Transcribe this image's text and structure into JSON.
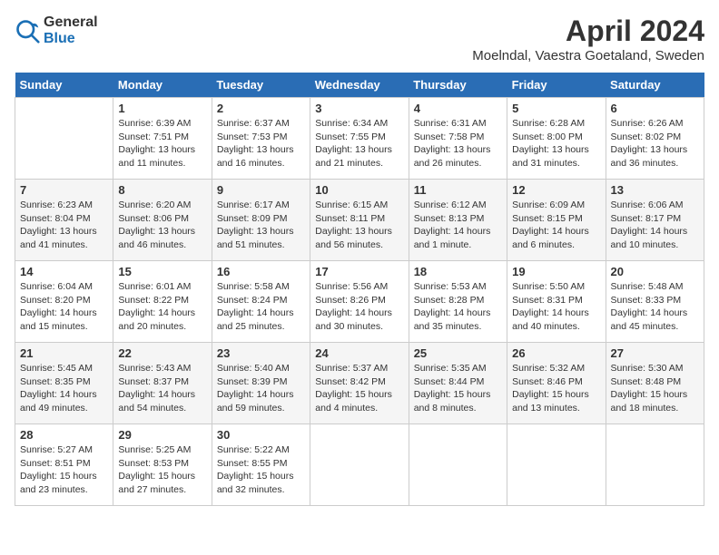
{
  "header": {
    "logo_general": "General",
    "logo_blue": "Blue",
    "month_title": "April 2024",
    "location": "Moelndal, Vaestra Goetaland, Sweden"
  },
  "days_of_week": [
    "Sunday",
    "Monday",
    "Tuesday",
    "Wednesday",
    "Thursday",
    "Friday",
    "Saturday"
  ],
  "weeks": [
    [
      {
        "day": "",
        "info": ""
      },
      {
        "day": "1",
        "info": "Sunrise: 6:39 AM\nSunset: 7:51 PM\nDaylight: 13 hours\nand 11 minutes."
      },
      {
        "day": "2",
        "info": "Sunrise: 6:37 AM\nSunset: 7:53 PM\nDaylight: 13 hours\nand 16 minutes."
      },
      {
        "day": "3",
        "info": "Sunrise: 6:34 AM\nSunset: 7:55 PM\nDaylight: 13 hours\nand 21 minutes."
      },
      {
        "day": "4",
        "info": "Sunrise: 6:31 AM\nSunset: 7:58 PM\nDaylight: 13 hours\nand 26 minutes."
      },
      {
        "day": "5",
        "info": "Sunrise: 6:28 AM\nSunset: 8:00 PM\nDaylight: 13 hours\nand 31 minutes."
      },
      {
        "day": "6",
        "info": "Sunrise: 6:26 AM\nSunset: 8:02 PM\nDaylight: 13 hours\nand 36 minutes."
      }
    ],
    [
      {
        "day": "7",
        "info": "Sunrise: 6:23 AM\nSunset: 8:04 PM\nDaylight: 13 hours\nand 41 minutes."
      },
      {
        "day": "8",
        "info": "Sunrise: 6:20 AM\nSunset: 8:06 PM\nDaylight: 13 hours\nand 46 minutes."
      },
      {
        "day": "9",
        "info": "Sunrise: 6:17 AM\nSunset: 8:09 PM\nDaylight: 13 hours\nand 51 minutes."
      },
      {
        "day": "10",
        "info": "Sunrise: 6:15 AM\nSunset: 8:11 PM\nDaylight: 13 hours\nand 56 minutes."
      },
      {
        "day": "11",
        "info": "Sunrise: 6:12 AM\nSunset: 8:13 PM\nDaylight: 14 hours\nand 1 minute."
      },
      {
        "day": "12",
        "info": "Sunrise: 6:09 AM\nSunset: 8:15 PM\nDaylight: 14 hours\nand 6 minutes."
      },
      {
        "day": "13",
        "info": "Sunrise: 6:06 AM\nSunset: 8:17 PM\nDaylight: 14 hours\nand 10 minutes."
      }
    ],
    [
      {
        "day": "14",
        "info": "Sunrise: 6:04 AM\nSunset: 8:20 PM\nDaylight: 14 hours\nand 15 minutes."
      },
      {
        "day": "15",
        "info": "Sunrise: 6:01 AM\nSunset: 8:22 PM\nDaylight: 14 hours\nand 20 minutes."
      },
      {
        "day": "16",
        "info": "Sunrise: 5:58 AM\nSunset: 8:24 PM\nDaylight: 14 hours\nand 25 minutes."
      },
      {
        "day": "17",
        "info": "Sunrise: 5:56 AM\nSunset: 8:26 PM\nDaylight: 14 hours\nand 30 minutes."
      },
      {
        "day": "18",
        "info": "Sunrise: 5:53 AM\nSunset: 8:28 PM\nDaylight: 14 hours\nand 35 minutes."
      },
      {
        "day": "19",
        "info": "Sunrise: 5:50 AM\nSunset: 8:31 PM\nDaylight: 14 hours\nand 40 minutes."
      },
      {
        "day": "20",
        "info": "Sunrise: 5:48 AM\nSunset: 8:33 PM\nDaylight: 14 hours\nand 45 minutes."
      }
    ],
    [
      {
        "day": "21",
        "info": "Sunrise: 5:45 AM\nSunset: 8:35 PM\nDaylight: 14 hours\nand 49 minutes."
      },
      {
        "day": "22",
        "info": "Sunrise: 5:43 AM\nSunset: 8:37 PM\nDaylight: 14 hours\nand 54 minutes."
      },
      {
        "day": "23",
        "info": "Sunrise: 5:40 AM\nSunset: 8:39 PM\nDaylight: 14 hours\nand 59 minutes."
      },
      {
        "day": "24",
        "info": "Sunrise: 5:37 AM\nSunset: 8:42 PM\nDaylight: 15 hours\nand 4 minutes."
      },
      {
        "day": "25",
        "info": "Sunrise: 5:35 AM\nSunset: 8:44 PM\nDaylight: 15 hours\nand 8 minutes."
      },
      {
        "day": "26",
        "info": "Sunrise: 5:32 AM\nSunset: 8:46 PM\nDaylight: 15 hours\nand 13 minutes."
      },
      {
        "day": "27",
        "info": "Sunrise: 5:30 AM\nSunset: 8:48 PM\nDaylight: 15 hours\nand 18 minutes."
      }
    ],
    [
      {
        "day": "28",
        "info": "Sunrise: 5:27 AM\nSunset: 8:51 PM\nDaylight: 15 hours\nand 23 minutes."
      },
      {
        "day": "29",
        "info": "Sunrise: 5:25 AM\nSunset: 8:53 PM\nDaylight: 15 hours\nand 27 minutes."
      },
      {
        "day": "30",
        "info": "Sunrise: 5:22 AM\nSunset: 8:55 PM\nDaylight: 15 hours\nand 32 minutes."
      },
      {
        "day": "",
        "info": ""
      },
      {
        "day": "",
        "info": ""
      },
      {
        "day": "",
        "info": ""
      },
      {
        "day": "",
        "info": ""
      }
    ]
  ]
}
